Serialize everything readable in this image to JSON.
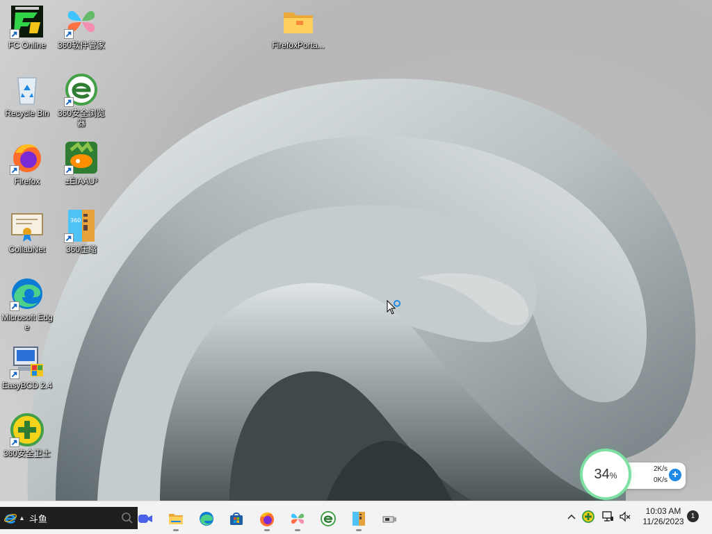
{
  "desktop": {
    "icons": [
      {
        "label": "FC Online",
        "icon": "fc-online-icon"
      },
      {
        "label": "360软件管家",
        "icon": "360-software-manager-icon"
      },
      {
        "label": "FirefoxPorta...",
        "icon": "folder-icon"
      },
      {
        "label": "Recycle Bin",
        "icon": "recycle-bin-icon"
      },
      {
        "label": "360安全浏览器",
        "icon": "360-browser-icon"
      },
      {
        "label": "Firefox",
        "icon": "firefox-icon"
      },
      {
        "label": "±ÉIAAU³",
        "icon": "game-icon"
      },
      {
        "label": "CollabNet",
        "icon": "certificate-icon"
      },
      {
        "label": "360压缩",
        "icon": "360-zip-icon"
      },
      {
        "label": "Microsoft Edge",
        "icon": "edge-icon"
      },
      {
        "label": "EasyBCD 2.4",
        "icon": "easybcd-icon"
      },
      {
        "label": "360安全卫士",
        "icon": "360-security-icon"
      }
    ]
  },
  "taskbar": {
    "search_text": "斗鱼",
    "apps": [
      "zoom-icon",
      "file-explorer-icon",
      "edge-icon",
      "microsoft-store-icon",
      "firefox-icon",
      "360-software-manager-icon",
      "360-browser-icon",
      "360-zip-icon",
      "usb-tool-icon"
    ]
  },
  "tray": {
    "time": "10:03 AM",
    "date": "11/26/2023",
    "notifications": "1"
  },
  "widget": {
    "percent": "34",
    "percent_unit": "%",
    "upload": "2K/s",
    "download": "0K/s",
    "plus": "+"
  },
  "colors": {
    "accent": "#1e88e5",
    "widget_ring": "#7fe0a3",
    "taskbar": "#f3f3f3"
  }
}
